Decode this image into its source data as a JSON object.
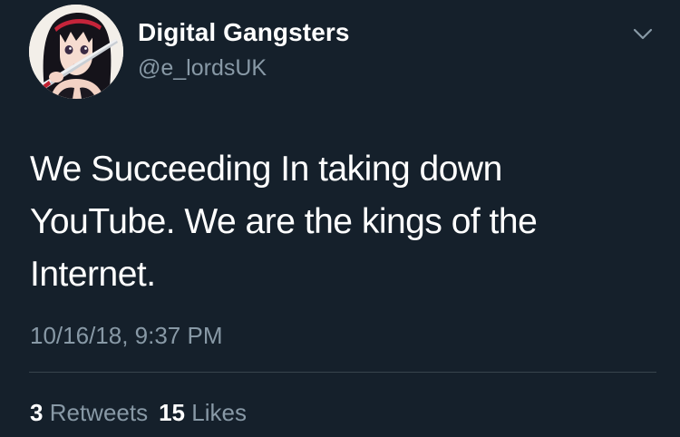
{
  "tweet": {
    "display_name": "Digital Gangsters",
    "handle": "@e_lordsUK",
    "text": "We Succeeding In taking down\nYouTube. We are the kings of the\nInternet.",
    "timestamp": "10/16/18, 9:37 PM",
    "retweets": {
      "count": "3",
      "label": "Retweets"
    },
    "likes": {
      "count": "15",
      "label": "Likes"
    }
  },
  "icons": {
    "menu": "chevron-down-icon",
    "avatar": "anime-character-avatar"
  },
  "colors": {
    "background": "#15202b",
    "primary_text": "#ffffff",
    "secondary_text": "#8899a6",
    "divider": "#38444d"
  }
}
